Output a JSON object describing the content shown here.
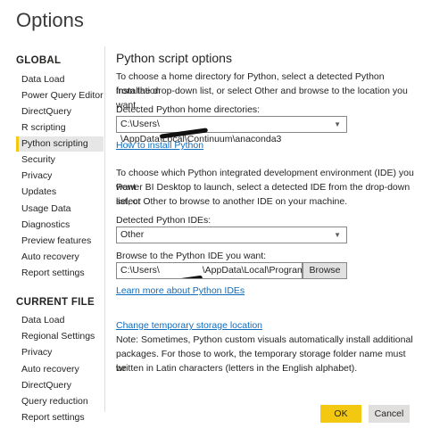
{
  "window": {
    "title": "Options"
  },
  "sidebar": {
    "global_header": "GLOBAL",
    "global_items": [
      {
        "label": "Data Load"
      },
      {
        "label": "Power Query Editor"
      },
      {
        "label": "DirectQuery"
      },
      {
        "label": "R scripting"
      },
      {
        "label": "Python scripting"
      },
      {
        "label": "Security"
      },
      {
        "label": "Privacy"
      },
      {
        "label": "Updates"
      },
      {
        "label": "Usage Data"
      },
      {
        "label": "Diagnostics"
      },
      {
        "label": "Preview features"
      },
      {
        "label": "Auto recovery"
      },
      {
        "label": "Report settings"
      }
    ],
    "active_item": "Python scripting",
    "current_file_header": "CURRENT FILE",
    "current_file_items": [
      {
        "label": "Data Load"
      },
      {
        "label": "Regional Settings"
      },
      {
        "label": "Privacy"
      },
      {
        "label": "Auto recovery"
      },
      {
        "label": "DirectQuery"
      },
      {
        "label": "Query reduction"
      },
      {
        "label": "Report settings"
      }
    ]
  },
  "main": {
    "title": "Python script options",
    "home_dir_intro_1": "To choose a home directory for Python, select a detected Python installation",
    "home_dir_intro_2": "from the drop-down list, or select Other and browse to the location you want.",
    "home_dir_label": "Detected Python home directories:",
    "home_dir_value_start": "C:\\Users\\",
    "home_dir_value_end": "\\AppData\\Local\\Continuum\\anaconda3",
    "install_link": "How to install Python",
    "ide_intro_1": "To choose which Python integrated development environment (IDE) you want",
    "ide_intro_2": "Power BI Desktop to launch, select a detected IDE from the drop-down list, or",
    "ide_intro_3": "select Other to browse to another IDE on your machine.",
    "ide_label": "Detected Python IDEs:",
    "ide_value": "Other",
    "browse_label": "Browse to the Python IDE you want:",
    "browse_value_start": "C:\\Users\\",
    "browse_value_end": "\\AppData\\Local\\Programs\\Micros",
    "browse_button": "Browse",
    "learn_link": "Learn more about Python IDEs",
    "storage_link": "Change temporary storage location",
    "note_1": "Note: Sometimes, Python custom visuals automatically install additional",
    "note_2": "packages. For those to work, the temporary storage folder name must be",
    "note_3": "written in Latin characters (letters in the English alphabet)."
  },
  "footer": {
    "ok_label": "OK",
    "cancel_label": "Cancel"
  },
  "colors": {
    "accent": "#f2c811",
    "link": "#0f6cbd",
    "active_bg": "#e6e6e6"
  },
  "icons": {
    "dropdown": "chevron-down-icon"
  }
}
